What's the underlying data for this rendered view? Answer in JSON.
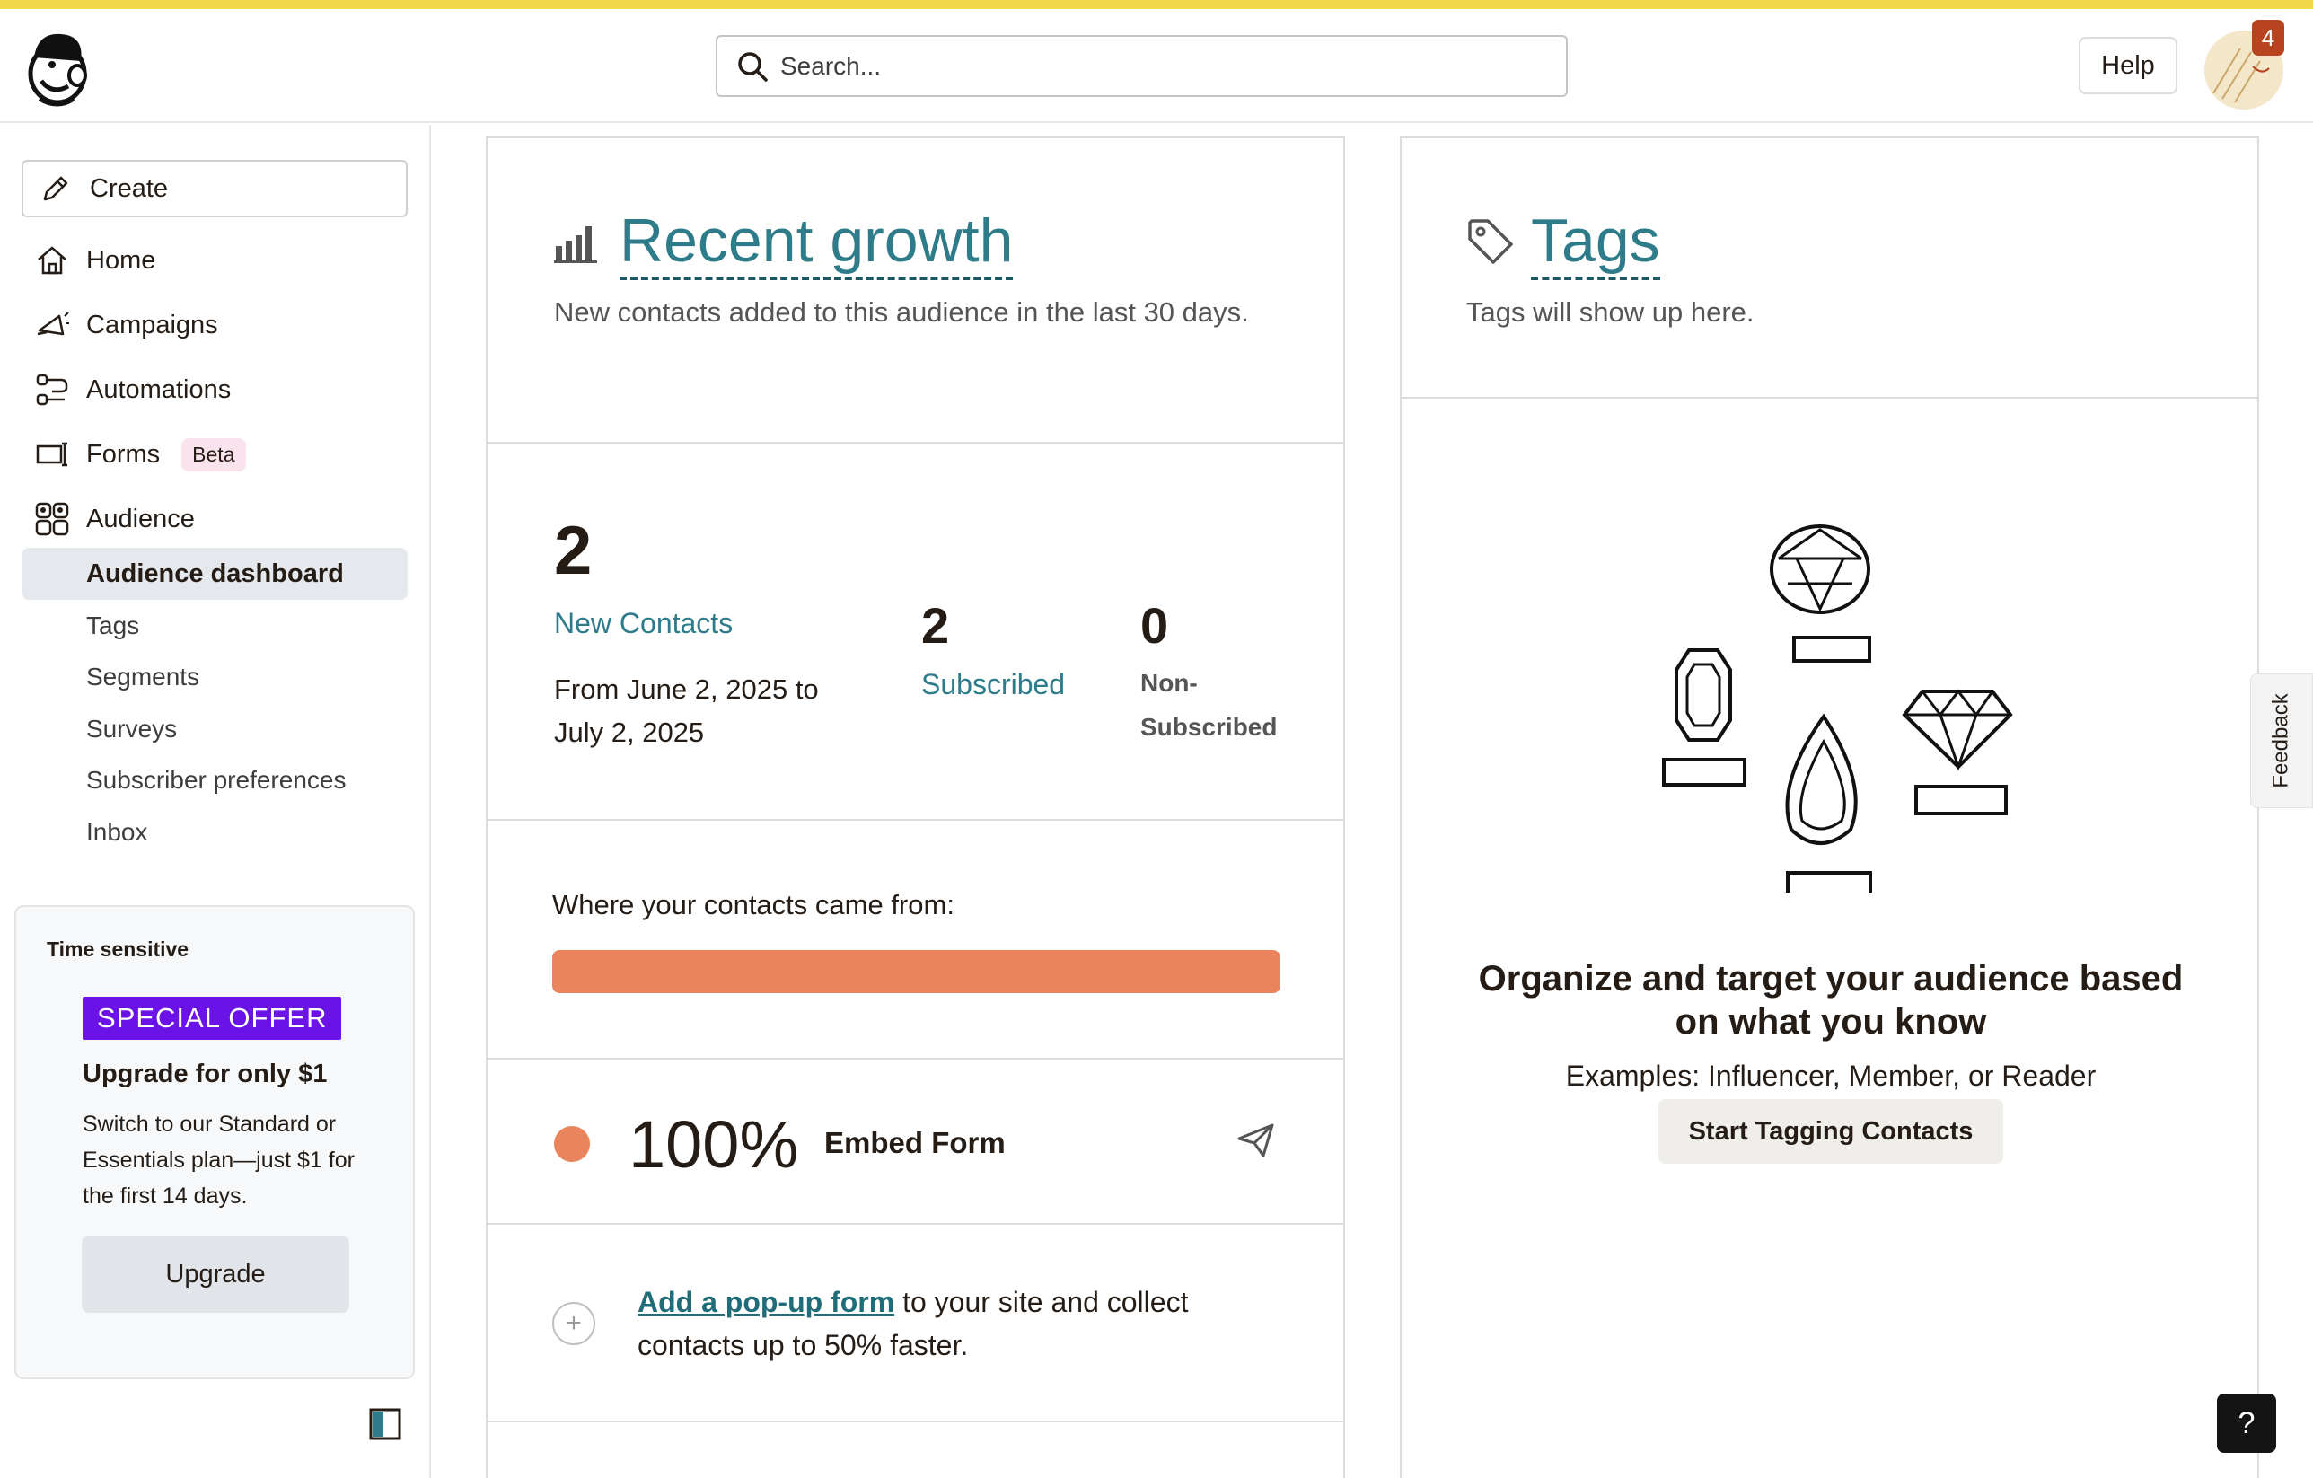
{
  "header": {
    "search_placeholder": "Search...",
    "help_label": "Help",
    "notification_count": "4"
  },
  "sidebar": {
    "create_label": "Create",
    "items": [
      {
        "label": "Home",
        "icon": "home-icon"
      },
      {
        "label": "Campaigns",
        "icon": "megaphone-icon"
      },
      {
        "label": "Automations",
        "icon": "automations-icon"
      },
      {
        "label": "Forms",
        "icon": "forms-icon",
        "badge": "Beta"
      },
      {
        "label": "Audience",
        "icon": "audience-icon"
      }
    ],
    "audience_subitems": [
      {
        "label": "Audience dashboard",
        "active": true
      },
      {
        "label": "Tags"
      },
      {
        "label": "Segments"
      },
      {
        "label": "Surveys"
      },
      {
        "label": "Subscriber preferences"
      },
      {
        "label": "Inbox"
      }
    ],
    "offer": {
      "time_sensitive": "Time sensitive",
      "special_offer": "SPECIAL OFFER",
      "headline": "Upgrade for only $1",
      "description": "Switch to our Standard or Essentials plan—just $1 for the first 14 days.",
      "upgrade_label": "Upgrade"
    }
  },
  "growth": {
    "title": "Recent growth",
    "subtitle": "New contacts added to this audience in the last 30 days.",
    "new_contacts_count": "2",
    "new_contacts_label": "New Contacts",
    "date_range": "From June 2, 2025 to July 2, 2025",
    "subscribed_count": "2",
    "subscribed_label": "Subscribed",
    "nonsubscribed_count": "0",
    "nonsubscribed_label": "Non-Subscribed",
    "sources_label": "Where your contacts came from:",
    "source_share": 1.0,
    "source_percent": "100%",
    "source_name": "Embed Form",
    "popup_link": "Add a pop-up form",
    "popup_text": " to your site and collect contacts up to 50% faster."
  },
  "tags": {
    "title": "Tags",
    "subtitle": "Tags will show up here.",
    "heading": "Organize and target your audience based on what you know",
    "examples": "Examples: Influencer, Member, or Reader",
    "button_label": "Start Tagging Contacts"
  },
  "feedback_label": "Feedback",
  "help_fab": "?",
  "colors": {
    "accent_teal": "#2e7c8a",
    "source_orange": "#ea845c",
    "offer_purple": "#6b12e6",
    "top_accent": "#f0d84a"
  }
}
